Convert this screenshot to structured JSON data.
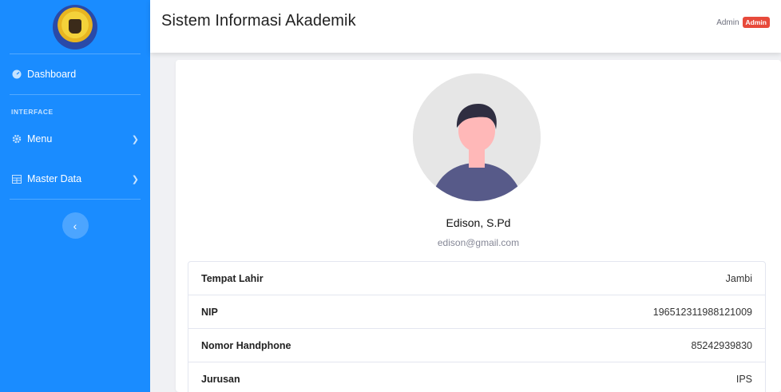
{
  "topbar": {
    "title": "Sistem Informasi Akademik",
    "user_name": "Admin",
    "role_badge": "Admin"
  },
  "sidebar": {
    "dashboard_label": "Dashboard",
    "section_heading": "INTERFACE",
    "items": [
      {
        "label": "Menu",
        "icon": "cog-icon"
      },
      {
        "label": "Master Data",
        "icon": "table-icon"
      }
    ]
  },
  "profile": {
    "name": "Edison, S.Pd",
    "email": "edison@gmail.com",
    "rows": [
      {
        "key": "Tempat Lahir",
        "value": "Jambi"
      },
      {
        "key": "NIP",
        "value": "196512311988121009"
      },
      {
        "key": "Nomor Handphone",
        "value": "85242939830"
      },
      {
        "key": "Jurusan",
        "value": "IPS"
      }
    ]
  },
  "colors": {
    "sidebar": "#1a8cff",
    "badge": "#e74a3b"
  }
}
